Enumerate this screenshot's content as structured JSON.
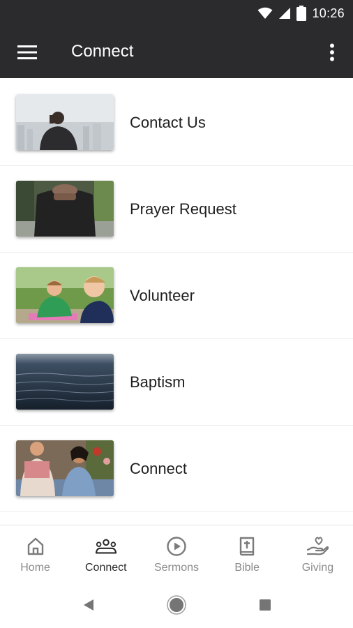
{
  "status_bar": {
    "time": "10:26"
  },
  "app_bar": {
    "title": "Connect"
  },
  "list_items": [
    {
      "label": "Contact Us"
    },
    {
      "label": "Prayer Request"
    },
    {
      "label": "Volunteer"
    },
    {
      "label": "Baptism"
    },
    {
      "label": "Connect"
    }
  ],
  "bottom_nav": [
    {
      "label": "Home",
      "icon": "home-icon"
    },
    {
      "label": "Connect",
      "icon": "people-icon",
      "active": true
    },
    {
      "label": "Sermons",
      "icon": "play-circle-icon"
    },
    {
      "label": "Bible",
      "icon": "bible-icon"
    },
    {
      "label": "Giving",
      "icon": "heart-hand-icon"
    }
  ],
  "colors": {
    "appbar": "#2b2b2e",
    "active_nav": "#2b2b2e",
    "inactive_nav": "#8a8a8a"
  }
}
